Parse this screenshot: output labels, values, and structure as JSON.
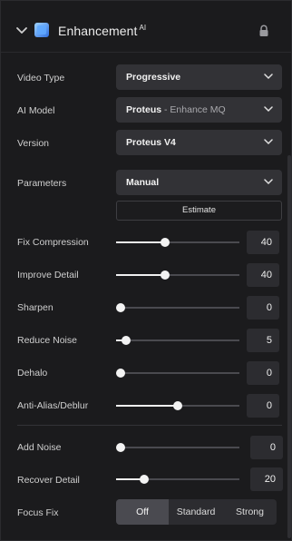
{
  "header": {
    "title": "Enhancement",
    "badge": "AI"
  },
  "fields": {
    "video_type": {
      "label": "Video Type",
      "value": "Progressive"
    },
    "ai_model": {
      "label": "AI Model",
      "value_main": "Proteus",
      "value_sub": " - Enhance MQ"
    },
    "version": {
      "label": "Version",
      "value": "Proteus V4"
    },
    "parameters": {
      "label": "Parameters",
      "value": "Manual"
    }
  },
  "estimate_label": "Estimate",
  "sliders": [
    {
      "label": "Fix Compression",
      "value": "40",
      "fraction": 0.4
    },
    {
      "label": "Improve Detail",
      "value": "40",
      "fraction": 0.4
    },
    {
      "label": "Sharpen",
      "value": "0",
      "fraction": 0.0
    },
    {
      "label": "Reduce Noise",
      "value": "5",
      "fraction": 0.08
    },
    {
      "label": "Dehalo",
      "value": "0",
      "fraction": 0.0
    },
    {
      "label": "Anti-Alias/Deblur",
      "value": "0",
      "fraction": 0.5
    },
    {
      "label": "Add Noise",
      "value": "0",
      "fraction": 0.0
    },
    {
      "label": "Recover Detail",
      "value": "20",
      "fraction": 0.23
    }
  ],
  "focus_fix": {
    "label": "Focus Fix",
    "options": [
      "Off",
      "Standard",
      "Strong"
    ],
    "selected": "Off"
  },
  "colors": {
    "background": "#1b1b1d",
    "control": "#323236",
    "accent_logo": "#3a8dff"
  },
  "icons": {
    "collapse": "chevron-down-icon",
    "logo": "enhancement-cube-icon",
    "lock": "lock-icon",
    "dropdown": "chevron-down-icon"
  }
}
